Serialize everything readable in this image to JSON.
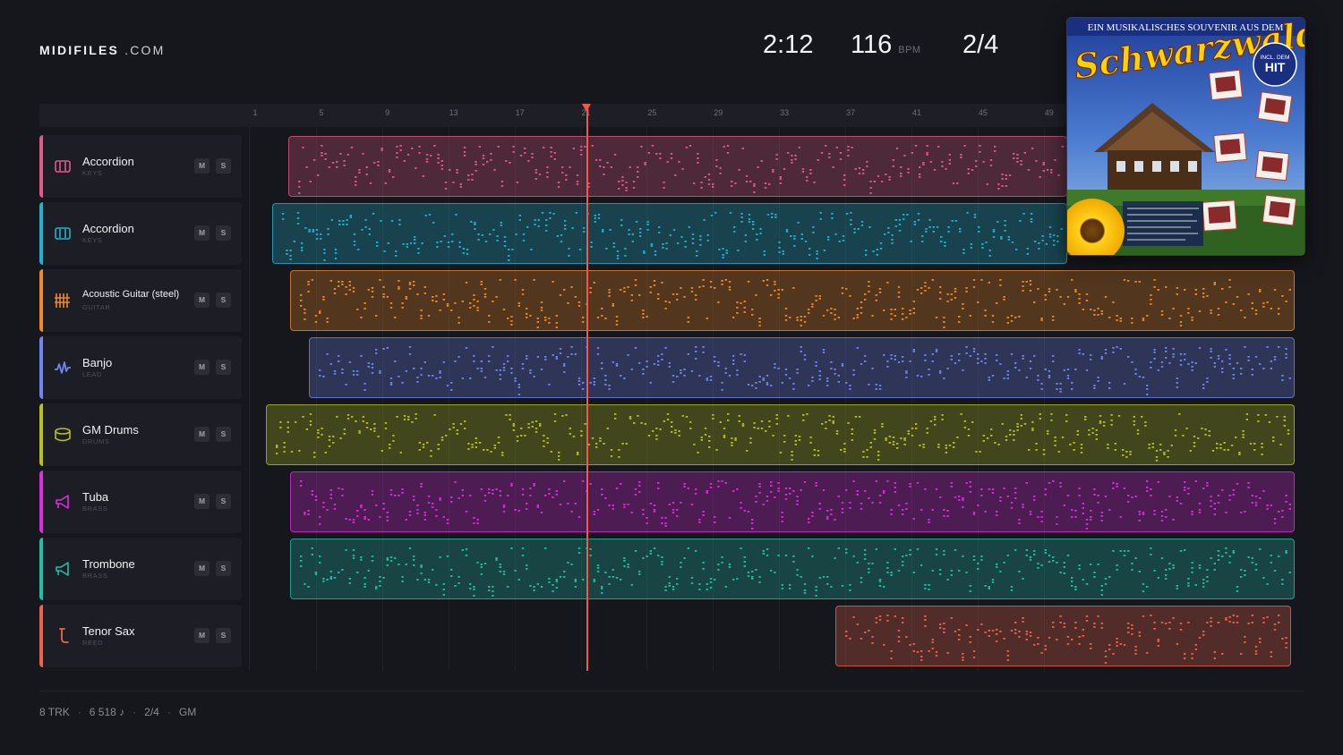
{
  "brand": {
    "name_bold": "MIDIFILES",
    "name_rest": ".COM"
  },
  "transport": {
    "time": "2:12",
    "tempo": "116",
    "tempo_unit": "BPM",
    "meter": "2/4"
  },
  "ruler": {
    "labels": [
      "1",
      "5",
      "9",
      "13",
      "17",
      "21",
      "25",
      "29",
      "33",
      "37",
      "41",
      "45",
      "49"
    ]
  },
  "playhead": {
    "label": "21"
  },
  "tracks": [
    {
      "name": "Accordion",
      "category": "KEYS",
      "icon": "piano-keys-icon",
      "color": "#e05a8a",
      "mute": "M",
      "solo": "S"
    },
    {
      "name": "Accordion",
      "category": "KEYS",
      "icon": "piano-keys-icon",
      "color": "#1fb3d0",
      "mute": "M",
      "solo": "S"
    },
    {
      "name": "Acoustic Guitar (steel)",
      "category": "GUITAR",
      "icon": "guitar-strings-icon",
      "color": "#f08a24",
      "mute": "M",
      "solo": "S"
    },
    {
      "name": "Banjo",
      "category": "LEAD",
      "icon": "waveform-icon",
      "color": "#6f86f0",
      "mute": "M",
      "solo": "S"
    },
    {
      "name": "GM Drums",
      "category": "DRUMS",
      "icon": "drum-icon",
      "color": "#b8c21c",
      "mute": "M",
      "solo": "S"
    },
    {
      "name": "Tuba",
      "category": "BRASS",
      "icon": "horn-icon",
      "color": "#e02ce0",
      "mute": "M",
      "solo": "S"
    },
    {
      "name": "Trombone",
      "category": "BRASS",
      "icon": "horn-icon",
      "color": "#1fc0a8",
      "mute": "M",
      "solo": "S"
    },
    {
      "name": "Tenor Sax",
      "category": "REED",
      "icon": "sax-icon",
      "color": "#f0634a",
      "mute": "M",
      "solo": "S"
    }
  ],
  "album": {
    "banner": "EIN MUSIKALISCHES SOUVENIR AUS DEM",
    "title": "Schwarzwald",
    "seal_line1": "INCL. DEM",
    "seal_line2": "HIT"
  },
  "footer": {
    "tracks": "8 TRK",
    "notes": "6 518 ♪",
    "meter": "2/4",
    "standard": "GM"
  }
}
